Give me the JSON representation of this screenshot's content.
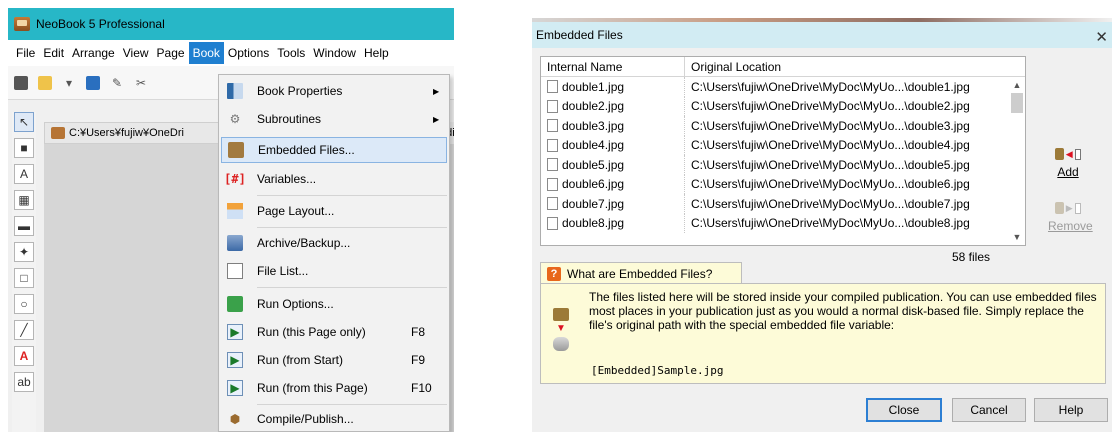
{
  "neobook": {
    "window_title": "NeoBook 5 Professional",
    "menu": [
      "File",
      "Edit",
      "Arrange",
      "View",
      "Page",
      "Book",
      "Options",
      "Tools",
      "Window",
      "Help"
    ],
    "active_menu": "Book",
    "document_path": "C:¥Users¥fujiw¥OneDri",
    "document_path_tail": "edia",
    "book_menu": {
      "items": [
        {
          "label": "Book Properties",
          "shortcut": "",
          "icon": "book-properties-icon",
          "submenu": true
        },
        {
          "label": "Subroutines",
          "shortcut": "",
          "icon": "gears-icon",
          "submenu": true
        },
        {
          "label": "Embedded Files...",
          "shortcut": "",
          "icon": "briefcase-icon",
          "submenu": false
        },
        {
          "label": "Variables...",
          "shortcut": "",
          "icon": "variables-icon",
          "submenu": false
        },
        {
          "label": "Page Layout...",
          "shortcut": "",
          "icon": "page-layout-icon",
          "submenu": false
        },
        {
          "label": "Archive/Backup...",
          "shortcut": "",
          "icon": "archive-icon",
          "submenu": false
        },
        {
          "label": "File List...",
          "shortcut": "",
          "icon": "file-list-icon",
          "submenu": false
        },
        {
          "label": "Run Options...",
          "shortcut": "",
          "icon": "run-options-icon",
          "submenu": false
        },
        {
          "label": "Run (this Page only)",
          "shortcut": "F8",
          "icon": "play-icon",
          "submenu": false
        },
        {
          "label": "Run (from Start)",
          "shortcut": "F9",
          "icon": "play-icon",
          "submenu": false
        },
        {
          "label": "Run (from this Page)",
          "shortcut": "F10",
          "icon": "play-page-icon",
          "submenu": false
        },
        {
          "label": "Compile/Publish...",
          "shortcut": "",
          "icon": "compile-icon",
          "submenu": false
        }
      ],
      "highlighted": "Embedded Files..."
    }
  },
  "dialog": {
    "title": "Embedded Files",
    "columns": [
      "Internal Name",
      "Original Location"
    ],
    "rows": [
      {
        "name": "double1.jpg",
        "location": "C:\\Users\\fujiw\\OneDrive\\MyDoc\\MyUo...\\double1.jpg"
      },
      {
        "name": "double2.jpg",
        "location": "C:\\Users\\fujiw\\OneDrive\\MyDoc\\MyUo...\\double2.jpg"
      },
      {
        "name": "double3.jpg",
        "location": "C:\\Users\\fujiw\\OneDrive\\MyDoc\\MyUo...\\double3.jpg"
      },
      {
        "name": "double4.jpg",
        "location": "C:\\Users\\fujiw\\OneDrive\\MyDoc\\MyUo...\\double4.jpg"
      },
      {
        "name": "double5.jpg",
        "location": "C:\\Users\\fujiw\\OneDrive\\MyDoc\\MyUo...\\double5.jpg"
      },
      {
        "name": "double6.jpg",
        "location": "C:\\Users\\fujiw\\OneDrive\\MyDoc\\MyUo...\\double6.jpg"
      },
      {
        "name": "double7.jpg",
        "location": "C:\\Users\\fujiw\\OneDrive\\MyDoc\\MyUo...\\double7.jpg"
      },
      {
        "name": "double8.jpg",
        "location": "C:\\Users\\fujiw\\OneDrive\\MyDoc\\MyUo...\\double8.jpg"
      }
    ],
    "file_count": "58 files",
    "add_label": "Add",
    "remove_label": "Remove",
    "help_tab": "What are Embedded Files?",
    "help_text": "The files listed here will be stored inside your compiled publication. You can use embedded files most places in your publication just as you would a normal disk-based file. Simply replace the file's original path with the special embedded file variable:",
    "help_code": "[Embedded]Sample.jpg",
    "buttons": {
      "close": "Close",
      "cancel": "Cancel",
      "help": "Help"
    }
  },
  "colors": {
    "neobook_titlebar": "#27b7c7",
    "menu_active": "#1f7fd0",
    "menu_highlight": "#dce9f8",
    "dialog_titlebar": "#d2ecf3",
    "help_background": "#fdfbd8",
    "primary_button_border": "#2d7fd3"
  }
}
